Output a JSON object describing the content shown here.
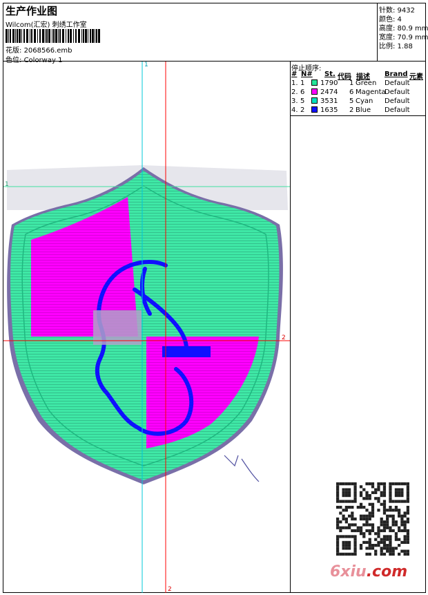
{
  "header": {
    "title": "生产作业图",
    "subtitle": "Wilcom(汇宏) 刺绣工作室",
    "design_label": "花版:",
    "design_value": "2068566.emb",
    "colorway_label": "色位:",
    "colorway_value": "Colorway 1"
  },
  "stats": {
    "stitches": "针数: 9432",
    "colors": "颜色: 4",
    "height": "高度: 80.9 mm",
    "width": "宽度: 70.9 mm",
    "scale": "比例: 1.88"
  },
  "stop_sequence": {
    "title": "停止顺序:",
    "columns": [
      "#",
      "N#",
      "St.",
      "代码",
      "描述",
      "Brand",
      "元素"
    ],
    "rows": [
      {
        "idx": "1.",
        "n": "1",
        "st": "1790",
        "code": "1",
        "desc": "Green",
        "brand": "Default",
        "color": "#25e69a"
      },
      {
        "idx": "2.",
        "n": "6",
        "st": "2474",
        "code": "6",
        "desc": "Magenta",
        "brand": "Default",
        "color": "#ff00ff"
      },
      {
        "idx": "3.",
        "n": "5",
        "st": "3531",
        "code": "5",
        "desc": "Cyan",
        "brand": "Default",
        "color": "#00e0c0"
      },
      {
        "idx": "4.",
        "n": "2",
        "st": "1635",
        "code": "2",
        "desc": "Blue",
        "brand": "Default",
        "color": "#1010ff"
      }
    ]
  },
  "guides": {
    "v1": "1",
    "h1": "1",
    "v2": "2",
    "h2": "2"
  },
  "watermark": {
    "part1": "6xiu",
    "part2": ".com"
  },
  "colors": {
    "cyan_guide": "#00c8d8",
    "red_guide": "#ff0000",
    "green_guide": "#40e0a0"
  }
}
